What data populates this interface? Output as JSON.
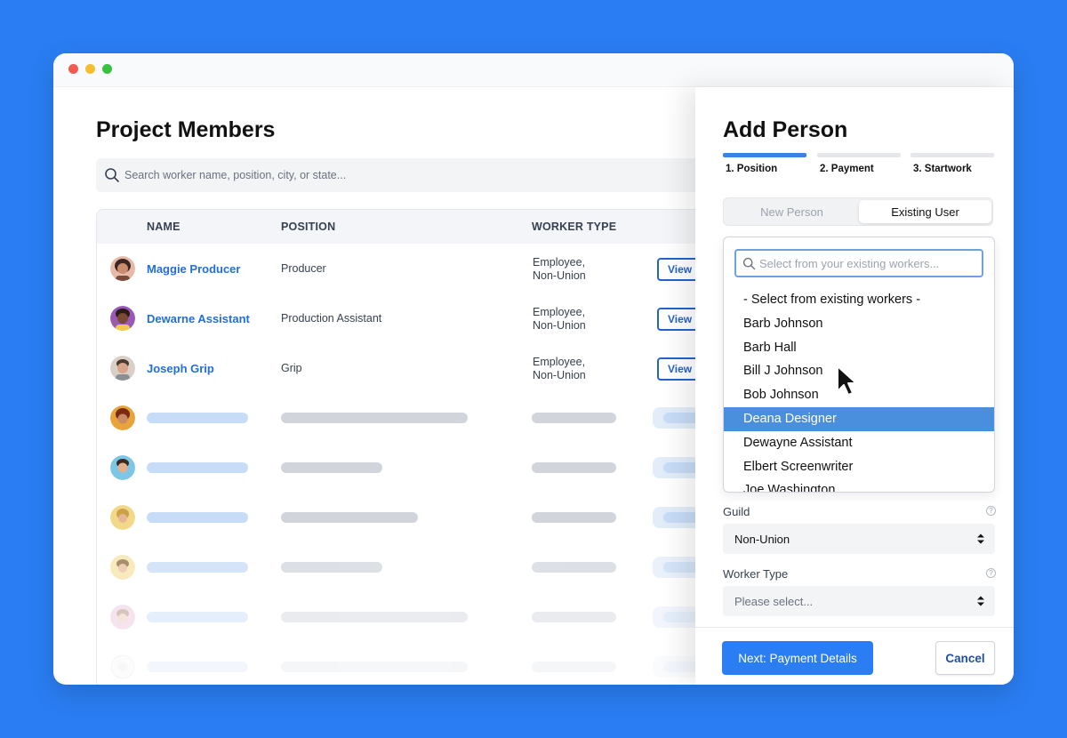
{
  "page": {
    "title": "Project Members",
    "search_placeholder": "Search worker name, position, city, or state..."
  },
  "table": {
    "headers": {
      "name": "NAME",
      "position": "POSITION",
      "worker_type": "WORKER TYPE"
    },
    "rows": [
      {
        "name": "Maggie Producer",
        "position": "Producer",
        "worker_type_line1": "Employee,",
        "worker_type_line2": "Non-Union",
        "action": "View"
      },
      {
        "name": "Dewarne Assistant",
        "position": "Production Assistant",
        "worker_type_line1": "Employee,",
        "worker_type_line2": "Non-Union",
        "action": "View"
      },
      {
        "name": "Joseph Grip",
        "position": "Grip",
        "worker_type_line1": "Employee,",
        "worker_type_line2": "Non-Union",
        "action": "View"
      }
    ]
  },
  "panel": {
    "title": "Add Person",
    "steps": [
      {
        "label": "1. Position",
        "active": true
      },
      {
        "label": "2. Payment",
        "active": false
      },
      {
        "label": "3. Startwork",
        "active": false
      }
    ],
    "toggle": {
      "new_label": "New Person",
      "existing_label": "Existing User",
      "selected": "Existing User"
    },
    "dropdown": {
      "placeholder": "Select from your existing workers...",
      "options": [
        "- Select from existing workers -",
        "Barb Johnson",
        "Barb Hall",
        "Bill J Johnson",
        "Bob Johnson",
        "Deana Designer",
        "Dewayne Assistant",
        "Elbert Screenwriter",
        "Joe Washington"
      ],
      "highlighted": "Deana Designer"
    },
    "guild": {
      "label": "Guild",
      "value": "Non-Union"
    },
    "worker_type": {
      "label": "Worker Type",
      "placeholder": "Please select..."
    },
    "buttons": {
      "next": "Next: Payment Details",
      "cancel": "Cancel"
    }
  },
  "colors": {
    "background": "#2a7df2",
    "link": "#1f6fd8",
    "accent": "#2a7df2",
    "highlight": "#4a8fde"
  }
}
